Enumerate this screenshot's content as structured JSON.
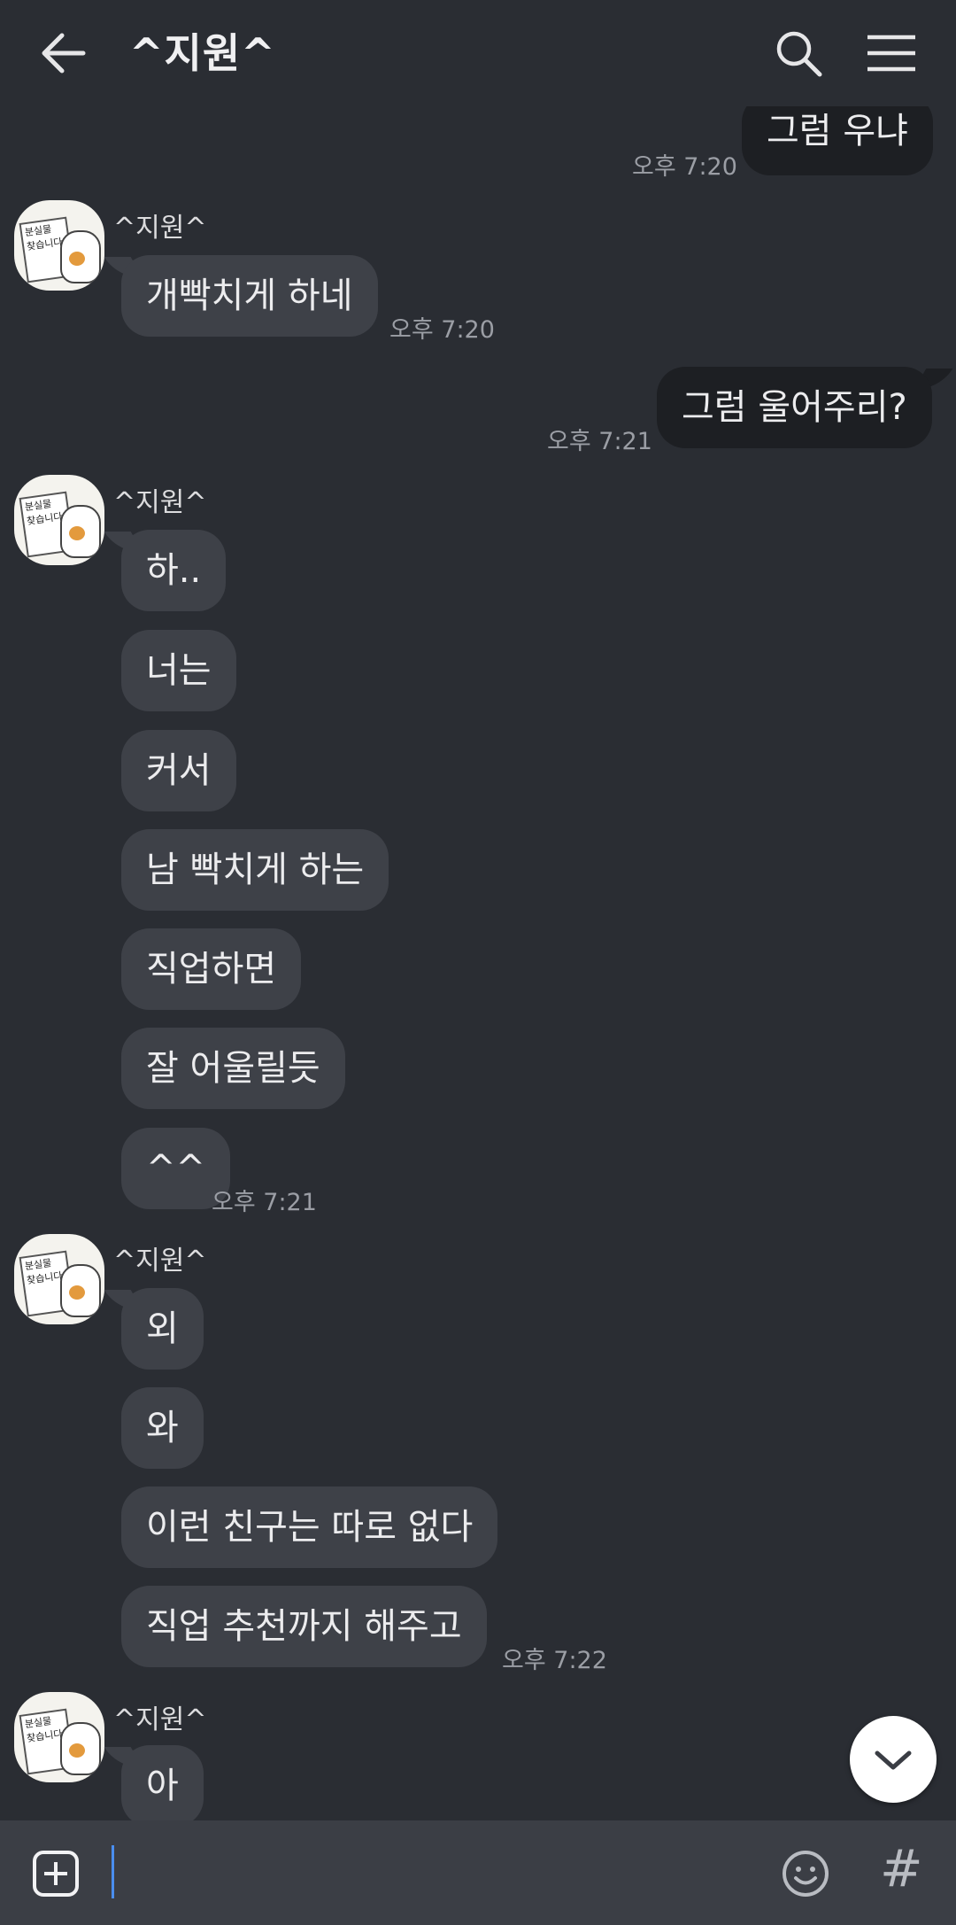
{
  "header": {
    "title": "^지원^"
  },
  "avatar_sign_lines": [
    "분실물",
    "찾습니다"
  ],
  "messages": {
    "m0": {
      "text": "그럼 우냐",
      "time": "오후 7:20"
    },
    "g1": {
      "sender": "^지원^",
      "m1": "개빡치게 하네",
      "time": "오후 7:20"
    },
    "m2": {
      "text": "그럼 울어주리?",
      "time": "오후 7:21"
    },
    "g2": {
      "sender": "^지원^",
      "m1": "하..",
      "m2": "너는",
      "m3": "커서",
      "m4": "남 빡치게 하는",
      "m5": "직업하면",
      "m6": "잘 어울릴듯",
      "m7": "^^",
      "time": "오후 7:21"
    },
    "g3": {
      "sender": "^지원^",
      "m1": "외",
      "m2": "와",
      "m3": "이런 친구는 따로 없다",
      "m4": "직업 추천까지 해주고",
      "time": "오후 7:22"
    },
    "g4": {
      "sender": "^지원^",
      "m1": "아"
    }
  },
  "icons": {
    "back": "arrow-left-icon",
    "search": "search-icon",
    "menu": "hamburger-menu-icon",
    "scroll_down": "chevron-down-icon",
    "attach": "plus-square-icon",
    "emoji": "smiley-icon",
    "hashtag": "hashtag-icon"
  },
  "input": {
    "hashtag_glyph": "#"
  },
  "colors": {
    "background": "#2a2d33",
    "incoming_bubble": "#3e4148",
    "outgoing_bubble": "#1d1f23",
    "input_bar": "#3b3e45",
    "cursor": "#4a8ef0"
  }
}
